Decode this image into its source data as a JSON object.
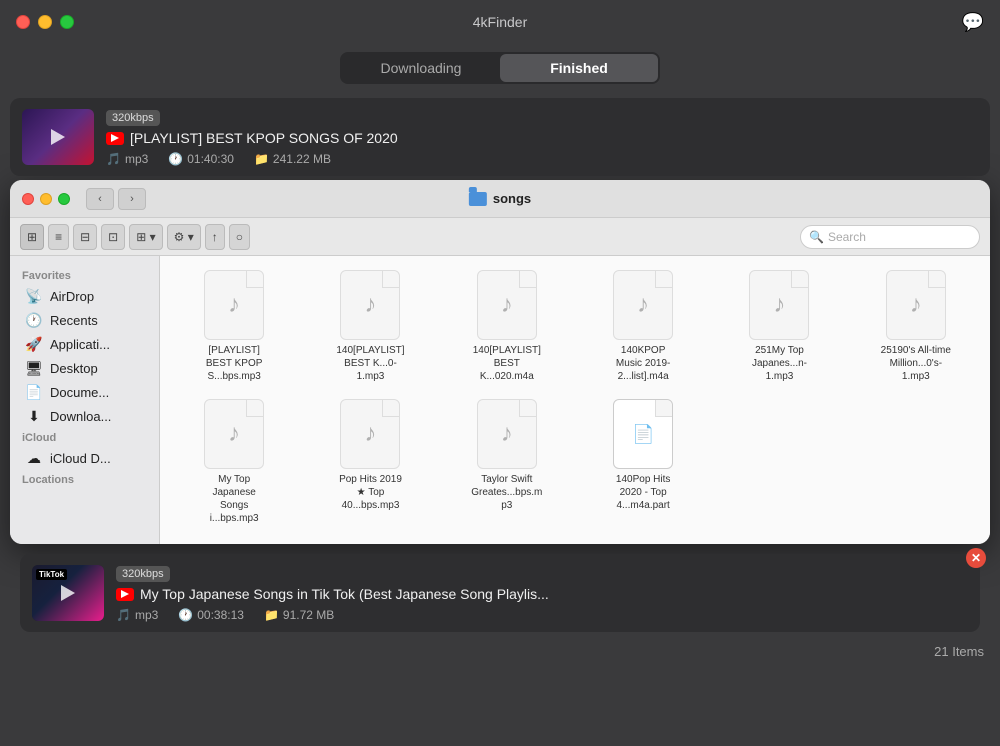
{
  "app": {
    "title": "4kFinder",
    "traffic_lights": [
      "close",
      "minimize",
      "maximize"
    ]
  },
  "tabs": {
    "downloading": "Downloading",
    "finished": "Finished",
    "active": "finished"
  },
  "download_item_1": {
    "kbps": "320kbps",
    "title": "[PLAYLIST] BEST KPOP SONGS OF 2020",
    "format": "mp3",
    "duration": "01:40:30",
    "size": "241.22 MB"
  },
  "finder": {
    "folder_name": "songs",
    "search_placeholder": "Search",
    "sidebar": {
      "favorites_label": "Favorites",
      "favorites": [
        {
          "id": "airdrop",
          "label": "AirDrop",
          "icon": "📡"
        },
        {
          "id": "recents",
          "label": "Recents",
          "icon": "🕐"
        },
        {
          "id": "applications",
          "label": "Applicati...",
          "icon": "🚀"
        },
        {
          "id": "desktop",
          "label": "Desktop",
          "icon": "🖥"
        },
        {
          "id": "documents",
          "label": "Docume...",
          "icon": "📄"
        },
        {
          "id": "downloads",
          "label": "Downloa...",
          "icon": "⬇"
        }
      ],
      "icloud_label": "iCloud",
      "icloud": [
        {
          "id": "icloud-drive",
          "label": "iCloud D...",
          "icon": "☁"
        }
      ],
      "locations_label": "Locations"
    },
    "files": [
      {
        "name": "[PLAYLIST] BEST KPOP S...bps.mp3",
        "partial": false
      },
      {
        "name": "140[PLAYLIST] BEST K...0-1.mp3",
        "partial": false
      },
      {
        "name": "140[PLAYLIST] BEST K...020.m4a",
        "partial": false
      },
      {
        "name": "140KPOP Music 2019-2...list].m4a",
        "partial": false
      },
      {
        "name": "251My Top Japanes...n-1.mp3",
        "partial": false
      },
      {
        "name": "25190's All-time Million...0's-1.mp3",
        "partial": false
      },
      {
        "name": "My Top Japanese Songs i...bps.mp3",
        "partial": false
      },
      {
        "name": "Pop Hits 2019 ★ Top 40...bps.mp3",
        "partial": false
      },
      {
        "name": "Taylor Swift Greates...bps.mp3",
        "partial": false
      },
      {
        "name": "140Pop Hits 2020 - Top 4...m4a.part",
        "partial": true
      }
    ]
  },
  "download_item_2": {
    "kbps": "320kbps",
    "title": "My Top Japanese Songs in Tik Tok (Best Japanese Song Playlis...",
    "format": "mp3",
    "duration": "00:38:13",
    "size": "91.72 MB"
  },
  "status_bar": {
    "items_count": "21 Items"
  },
  "toolbar": {
    "back": "‹",
    "forward": "›",
    "view_grid": "⊞",
    "view_list": "≡",
    "view_columns": "⊟",
    "view_cover": "⊡",
    "view_group": "⊞",
    "gear": "⚙",
    "share": "↑",
    "tags": "○"
  }
}
